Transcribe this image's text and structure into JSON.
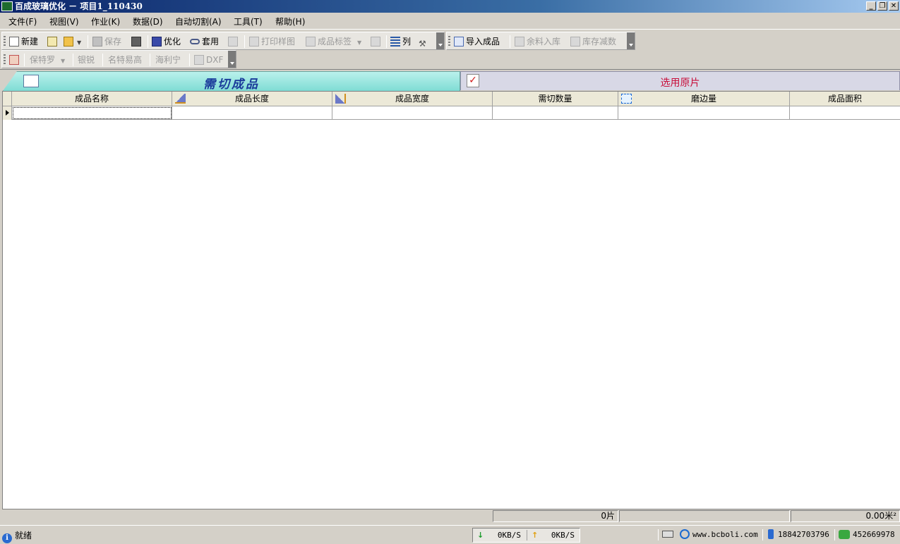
{
  "window": {
    "title": "百成玻璃优化 － 项目1_110430",
    "minimize": "_",
    "restore": "❐",
    "close": "✕"
  },
  "menu": [
    "文件(F)",
    "视图(V)",
    "作业(K)",
    "数据(D)",
    "自动切割(A)",
    "工具(T)",
    "帮助(H)"
  ],
  "toolbar1": {
    "new": "新建",
    "save": "保存",
    "optimize": "优化",
    "apply": "套用",
    "print_sample": "打印样图",
    "product_label": "成品标签",
    "columns": "列"
  },
  "toolbar2": {
    "import_products": "导入成品",
    "remnant_in": "余料入库",
    "stock_reduce": "库存减数"
  },
  "toolbar3": {
    "baoteluo": "保特罗",
    "yinrui": "银锐",
    "mingte": "名特易高",
    "hailining": "海利宁",
    "dxf": "DXF"
  },
  "tabs": {
    "active": "需切成品",
    "inactive": "选用原片"
  },
  "grid": {
    "columns": [
      "成品名称",
      "成品长度",
      "成品宽度",
      "需切数量",
      "磨边量",
      "成品面积"
    ],
    "rows": [
      [
        "",
        "",
        "",
        "",
        "",
        ""
      ]
    ]
  },
  "summary": {
    "count": "0片",
    "area": "0.00米²"
  },
  "status": {
    "text": "就绪",
    "download_speed": "0KB/S",
    "upload_speed": "0KB/S",
    "website": "www.bcboli.com",
    "phone": "18842703796",
    "qq": "452669978"
  }
}
